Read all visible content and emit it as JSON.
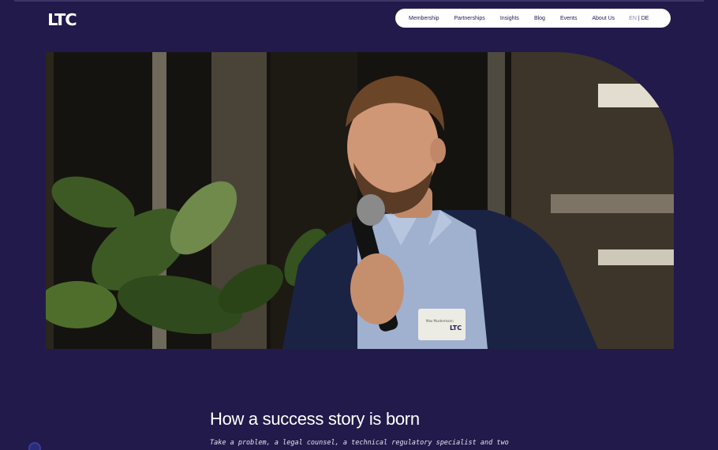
{
  "brand": {
    "logo_text": "LTC"
  },
  "nav": {
    "items": [
      "Membership",
      "Partnerships",
      "Insights",
      "Blog",
      "Events",
      "About Us"
    ],
    "lang": {
      "active": "EN",
      "separator": "|",
      "other": "DE"
    }
  },
  "hero": {
    "badge_text": "LTC",
    "badge_name": "Max Mustermann"
  },
  "content": {
    "heading": "How a success story is born",
    "intro": "Take a problem, a legal counsel, a technical regulatory specialist and two"
  },
  "colors": {
    "background": "#221a4a",
    "nav_bg": "#ffffff",
    "text": "#ffffff"
  }
}
